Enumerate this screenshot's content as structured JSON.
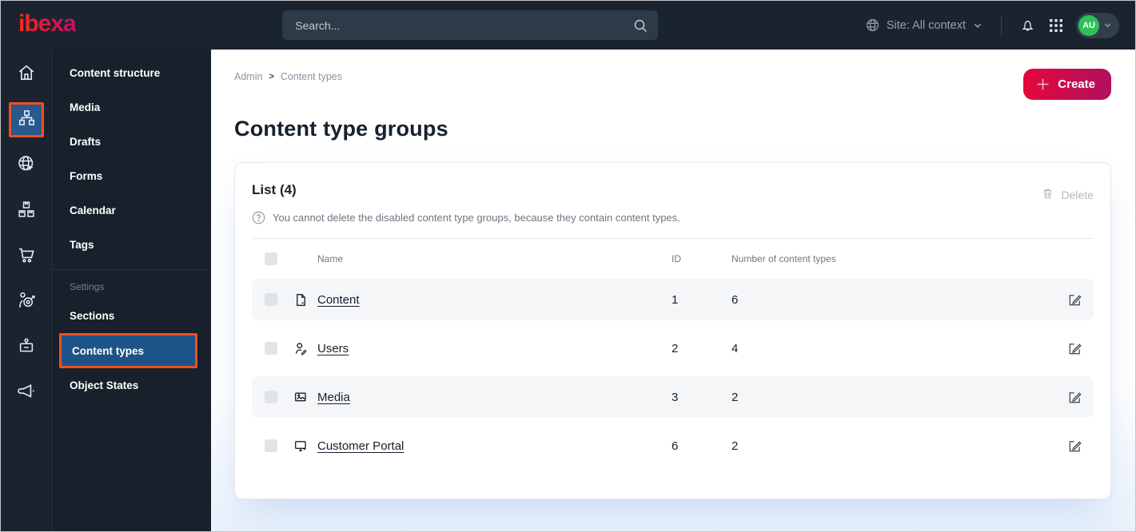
{
  "topbar": {
    "logo": "ibexa",
    "search_placeholder": "Search...",
    "site_context": "Site: All context",
    "avatar_initials": "AU"
  },
  "sidebar": {
    "items": [
      {
        "label": "Content structure"
      },
      {
        "label": "Media"
      },
      {
        "label": "Drafts"
      },
      {
        "label": "Forms"
      },
      {
        "label": "Calendar"
      },
      {
        "label": "Tags"
      }
    ],
    "section_label": "Settings",
    "settings_items": [
      {
        "label": "Sections",
        "selected": false
      },
      {
        "label": "Content types",
        "selected": true
      },
      {
        "label": "Object States",
        "selected": false
      }
    ]
  },
  "main": {
    "breadcrumb": {
      "0": "Admin",
      "1": "Content types",
      "separator": ">"
    },
    "create_label": "Create",
    "page_title": "Content type groups",
    "list": {
      "title": "List (4)",
      "help_text": "You cannot delete the disabled content type groups, because they contain content types.",
      "delete_label": "Delete",
      "columns": {
        "name": "Name",
        "id": "ID",
        "count": "Number of content types"
      },
      "rows": [
        {
          "icon": "content-file-icon",
          "name": "Content",
          "id": "1",
          "count": "6"
        },
        {
          "icon": "users-icon",
          "name": "Users",
          "id": "2",
          "count": "4"
        },
        {
          "icon": "media-image-icon",
          "name": "Media",
          "id": "3",
          "count": "2"
        },
        {
          "icon": "customer-portal-icon",
          "name": "Customer Portal",
          "id": "6",
          "count": "2"
        }
      ]
    }
  },
  "colors": {
    "topbar_bg": "#1a2430",
    "selected_blue": "#1d5386",
    "annotation_orange": "#f04f1f",
    "create_gradient_start": "#e4083b",
    "create_gradient_end": "#b01060",
    "avatar_green": "#2bc258",
    "zebra_row": "#f5f6f8"
  }
}
